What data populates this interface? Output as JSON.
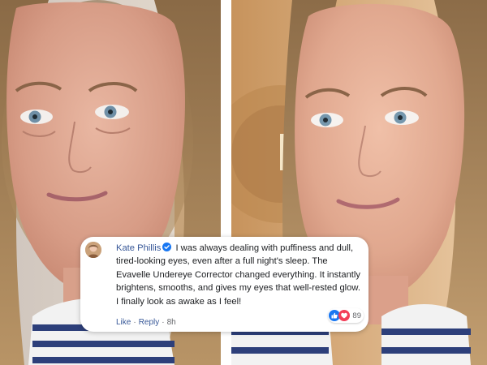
{
  "comment": {
    "author": "Kate Phillis",
    "text": "I was always dealing with puffiness and dull, tired-looking eyes, even after a full night's sleep. The Evavelle Undereye Corrector changed everything. It instantly brightens, smooths, and gives my eyes that well-rested glow. I finally look as awake as I feel!",
    "reaction_count": "89",
    "like_label": "Like",
    "reply_label": "Reply",
    "separator": "·",
    "time": "8h"
  },
  "icons": {
    "verified": "verified-badge-icon",
    "like": "like-thumb-icon",
    "love": "love-heart-icon"
  },
  "colors": {
    "author": "#385898",
    "verified": "#1877f2",
    "like": "#1877f2",
    "love": "#f33e58"
  }
}
